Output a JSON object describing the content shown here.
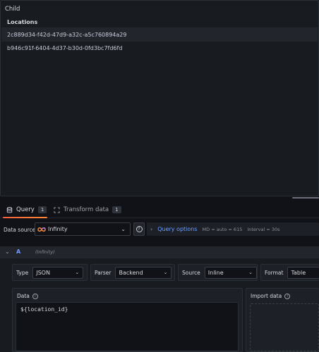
{
  "panel": {
    "title": "Child",
    "table": {
      "header": "Locations",
      "rows": [
        "2c889d34-f42d-47d9-a32c-a5c760894a29",
        "b946c91f-6404-4d37-b30d-0fd3bc7fd6fd"
      ]
    }
  },
  "tabs": [
    {
      "label": "Query",
      "count": "1",
      "icon": "database-icon"
    },
    {
      "label": "Transform data",
      "count": "1",
      "icon": "transform-icon"
    }
  ],
  "toolbar": {
    "datasource_label": "Data source",
    "datasource_value": "Infinity",
    "query_options_label": "Query options",
    "md_text": "MD = auto = 615",
    "interval_text": "Interval = 30s"
  },
  "query": {
    "ref_id": "A",
    "datasource_name": "(Infinity)",
    "type_label": "Type",
    "type_value": "JSON",
    "parser_label": "Parser",
    "parser_value": "Backend",
    "source_label": "Source",
    "source_value": "Inline",
    "format_label": "Format",
    "format_value": "Table",
    "data_label": "Data",
    "data_value": "${location_id}",
    "import_label": "Import data"
  },
  "colors": {
    "background": "#111217",
    "panel": "#181b1f",
    "accent_blue": "#6e9fff",
    "tab_underline": "#f55f3e"
  }
}
